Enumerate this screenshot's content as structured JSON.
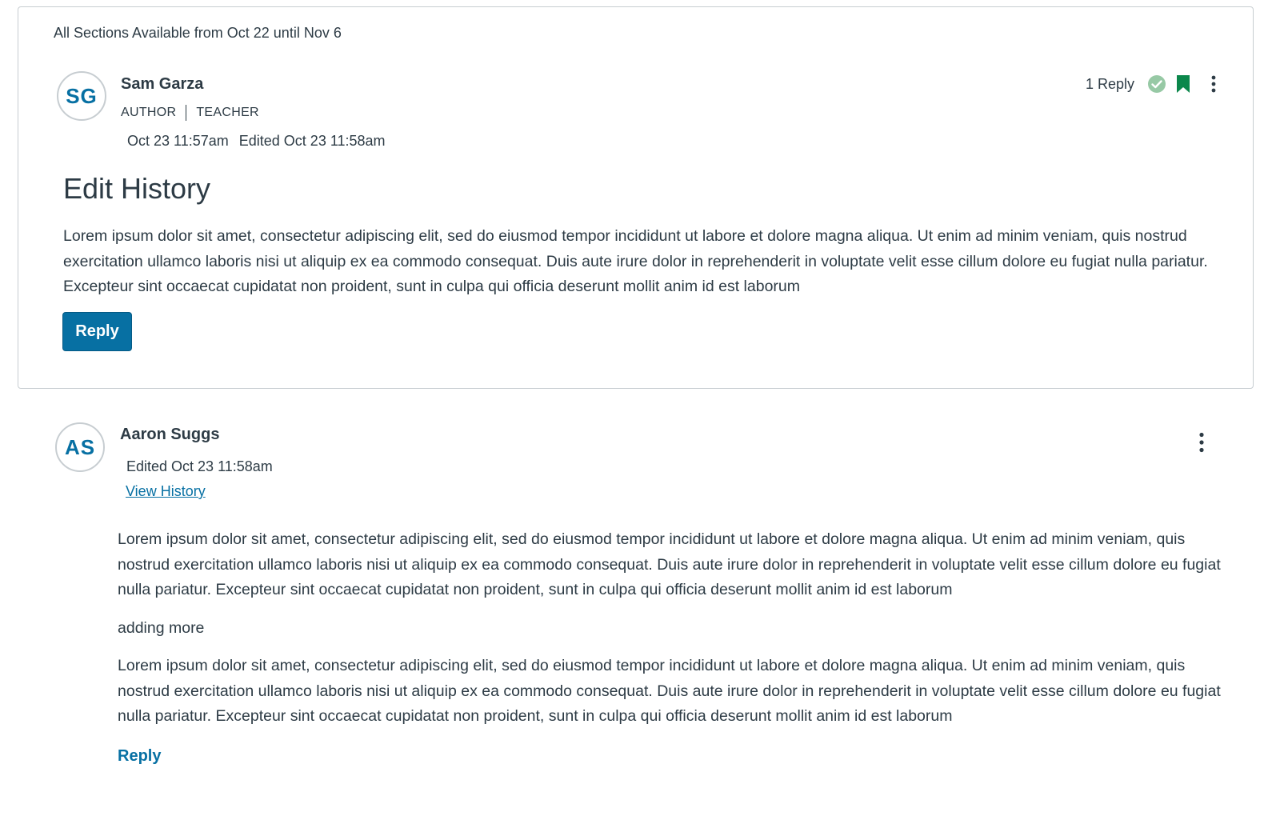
{
  "topic": {
    "availability": "All Sections Available from Oct 22 until Nov 6",
    "author": {
      "initials": "SG",
      "name": "Sam Garza",
      "role_1": "AUTHOR",
      "role_2": "TEACHER"
    },
    "posted_at": "Oct 23 11:57am",
    "edited_at": "Edited Oct 23 11:58am",
    "title": "Edit History",
    "body": "Lorem ipsum dolor sit amet, consectetur adipiscing elit, sed do eiusmod tempor incididunt ut labore et dolore magna aliqua. Ut enim ad minim veniam, quis nostrud exercitation ullamco laboris nisi ut aliquip ex ea commodo consequat. Duis aute irure dolor in reprehenderit in voluptate velit esse cillum dolore eu fugiat nulla pariatur. Excepteur sint occaecat cupidatat non proident, sunt in culpa qui officia deserunt mollit anim id est laborum",
    "reply_button_label": "Reply",
    "reply_count_label": "1 Reply",
    "icons": {
      "read_status": "check-circle-icon",
      "bookmark": "bookmark-icon",
      "menu": "kebab-menu-icon"
    },
    "colors": {
      "accent": "#0770a3",
      "read_check": "#97c9a5",
      "bookmark": "#0b874b"
    }
  },
  "entry": {
    "author": {
      "initials": "AS",
      "name": "Aaron Suggs"
    },
    "edited_at": "Edited Oct 23 11:58am",
    "view_history_label": "View History",
    "paragraphs": [
      "Lorem ipsum dolor sit amet, consectetur adipiscing elit, sed do eiusmod tempor incididunt ut labore et dolore magna aliqua. Ut enim ad minim veniam, quis nostrud exercitation ullamco laboris nisi ut aliquip ex ea commodo consequat. Duis aute irure dolor in reprehenderit in voluptate velit esse cillum dolore eu fugiat nulla pariatur. Excepteur sint occaecat cupidatat non proident, sunt in culpa qui officia deserunt mollit anim id est laborum",
      "adding more",
      "Lorem ipsum dolor sit amet, consectetur adipiscing elit, sed do eiusmod tempor incididunt ut labore et dolore magna aliqua. Ut enim ad minim veniam, quis nostrud exercitation ullamco laboris nisi ut aliquip ex ea commodo consequat. Duis aute irure dolor in reprehenderit in voluptate velit esse cillum dolore eu fugiat nulla pariatur. Excepteur sint occaecat cupidatat non proident, sunt in culpa qui officia deserunt mollit anim id est laborum"
    ],
    "reply_link_label": "Reply"
  }
}
